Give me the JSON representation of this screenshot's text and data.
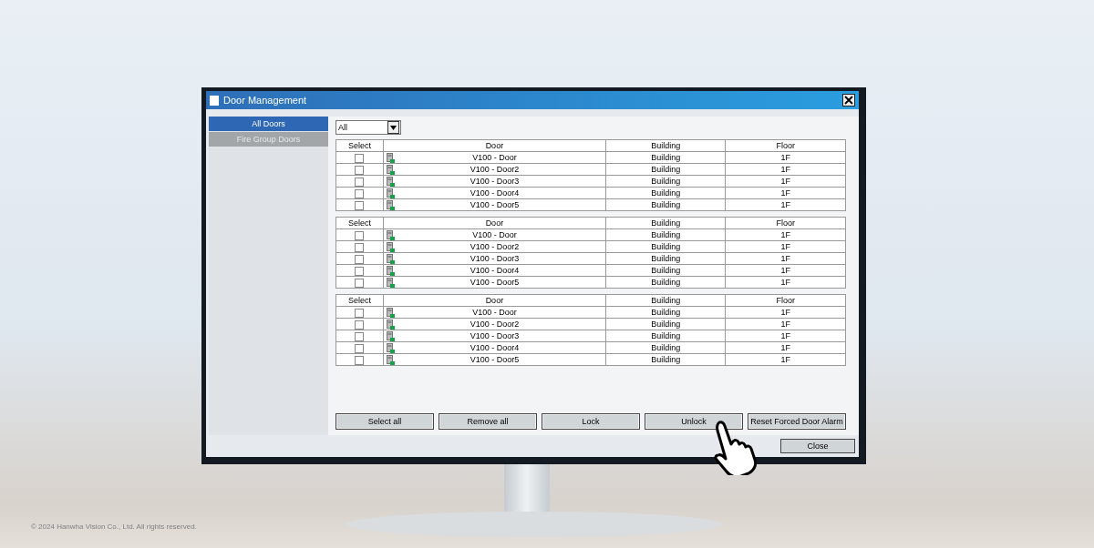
{
  "window": {
    "title": "Door Management"
  },
  "sidebar": {
    "items": [
      {
        "label": "All Doors",
        "selected": true
      },
      {
        "label": "Fire Group Doors",
        "selected": false
      }
    ]
  },
  "filter": {
    "value": "All"
  },
  "tables": [
    {
      "columns": [
        "Select",
        "Door",
        "Building",
        "Floor"
      ],
      "rows": [
        {
          "checked": false,
          "door": "V100 - Door",
          "building": "Building",
          "floor": "1F"
        },
        {
          "checked": false,
          "door": "V100 - Door2",
          "building": "Building",
          "floor": "1F"
        },
        {
          "checked": false,
          "door": "V100 - Door3",
          "building": "Building",
          "floor": "1F"
        },
        {
          "checked": false,
          "door": "V100 - Door4",
          "building": "Building",
          "floor": "1F"
        },
        {
          "checked": false,
          "door": "V100 - Door5",
          "building": "Building",
          "floor": "1F"
        }
      ]
    },
    {
      "columns": [
        "Select",
        "Door",
        "Building",
        "Floor"
      ],
      "rows": [
        {
          "checked": false,
          "door": "V100 - Door",
          "building": "Building",
          "floor": "1F"
        },
        {
          "checked": false,
          "door": "V100 - Door2",
          "building": "Building",
          "floor": "1F"
        },
        {
          "checked": false,
          "door": "V100 - Door3",
          "building": "Building",
          "floor": "1F"
        },
        {
          "checked": false,
          "door": "V100 - Door4",
          "building": "Building",
          "floor": "1F"
        },
        {
          "checked": false,
          "door": "V100 - Door5",
          "building": "Building",
          "floor": "1F"
        }
      ]
    },
    {
      "columns": [
        "Select",
        "Door",
        "Building",
        "Floor"
      ],
      "rows": [
        {
          "checked": false,
          "door": "V100 - Door",
          "building": "Building",
          "floor": "1F"
        },
        {
          "checked": false,
          "door": "V100 - Door2",
          "building": "Building",
          "floor": "1F"
        },
        {
          "checked": false,
          "door": "V100 - Door3",
          "building": "Building",
          "floor": "1F"
        },
        {
          "checked": false,
          "door": "V100 - Door4",
          "building": "Building",
          "floor": "1F"
        },
        {
          "checked": false,
          "door": "V100 - Door5",
          "building": "Building",
          "floor": "1F"
        }
      ]
    }
  ],
  "actions": [
    "Select all",
    "Remove all",
    "Lock",
    "Unlock",
    "Reset Forced Door Alarm"
  ],
  "close_button": "Close",
  "copyright": "© 2024 Hanwha Vision Co., Ltd. All rights reserved."
}
